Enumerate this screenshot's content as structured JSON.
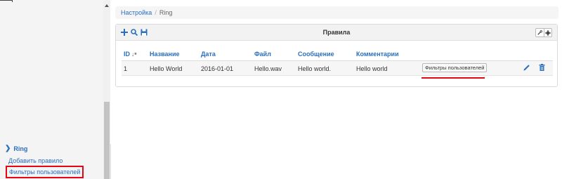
{
  "sidebar": {
    "section_label": "Ring",
    "items": [
      {
        "label": "Добавить правило"
      },
      {
        "label": "Фильтры пользователей",
        "highlighted": true
      }
    ]
  },
  "breadcrumb": {
    "items": [
      "Настройка",
      "Ring"
    ],
    "separator": "/"
  },
  "panel": {
    "title": "Правила",
    "toolbar_icons": [
      "add-icon",
      "search-icon",
      "save-icon"
    ],
    "header_buttons": [
      "wrench-icon",
      "gear-icon"
    ]
  },
  "table": {
    "columns": [
      "ID",
      "Название",
      "Дата",
      "Файл",
      "Сообщение",
      "Комментарии"
    ],
    "rows": [
      {
        "id": "1",
        "name": "Hello World",
        "date": "2016-01-01",
        "file": "Hello.wav",
        "message": "Hello world.",
        "comment": "Hello world",
        "filter_button": "Фильтры пользователей"
      }
    ]
  },
  "colors": {
    "link": "#2a6fbf",
    "highlight": "#e30613"
  }
}
